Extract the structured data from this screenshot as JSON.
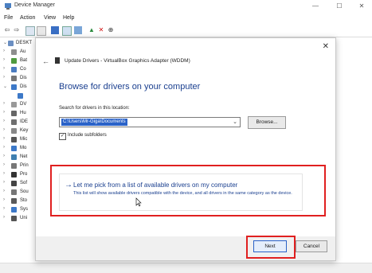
{
  "window": {
    "title": "Device Manager",
    "minimize": "—",
    "maximize": "☐",
    "close": "✕"
  },
  "menu": {
    "items": [
      "File",
      "Action",
      "View",
      "Help"
    ]
  },
  "toolbar": {
    "icons": [
      "back-arrow",
      "forward-arrow",
      "properties",
      "computer",
      "help",
      "scan",
      "update-driver",
      "uninstall",
      "scan-hardware"
    ]
  },
  "tree": {
    "root": "DESKT",
    "items": [
      {
        "label": "Au",
        "expanded": false
      },
      {
        "label": "Bat",
        "expanded": false
      },
      {
        "label": "Co",
        "expanded": false
      },
      {
        "label": "Dis",
        "expanded": false
      },
      {
        "label": "Dis",
        "expanded": true
      },
      {
        "label": "",
        "expanded": false
      },
      {
        "label": "DV",
        "expanded": false
      },
      {
        "label": "Hu",
        "expanded": false
      },
      {
        "label": "IDE",
        "expanded": false
      },
      {
        "label": "Key",
        "expanded": false
      },
      {
        "label": "Mic",
        "expanded": false
      },
      {
        "label": "Mo",
        "expanded": false
      },
      {
        "label": "Net",
        "expanded": false
      },
      {
        "label": "Prin",
        "expanded": false
      },
      {
        "label": "Pro",
        "expanded": false
      },
      {
        "label": "Sof",
        "expanded": false
      },
      {
        "label": "Sou",
        "expanded": false
      },
      {
        "label": "Sto",
        "expanded": false
      },
      {
        "label": "Sys",
        "expanded": false
      },
      {
        "label": "Uni",
        "expanded": false
      }
    ]
  },
  "dialog": {
    "close": "✕",
    "back": "←",
    "title": "Update Drivers - VirtualBox Graphics Adapter (WDDM)",
    "heading": "Browse for drivers on your computer",
    "search_label": "Search for drivers in this location:",
    "path_value": "C:\\Users\\Mr-Giga\\Documents",
    "path_arrow": "⌄",
    "browse_label": "Browse...",
    "include_subfolders_checked": true,
    "include_subfolders_label": "Include subfolders",
    "pick_arrow": "→",
    "pick_title": "Let me pick from a list of available drivers on my computer",
    "pick_desc": "This list will show available drivers compatible with the device, and all drivers in the same category as the device.",
    "next_label": "Next",
    "cancel_label": "Cancel"
  },
  "colors": {
    "accent": "#1a3f8f",
    "selection": "#2a62c8",
    "highlight": "#e02020"
  }
}
